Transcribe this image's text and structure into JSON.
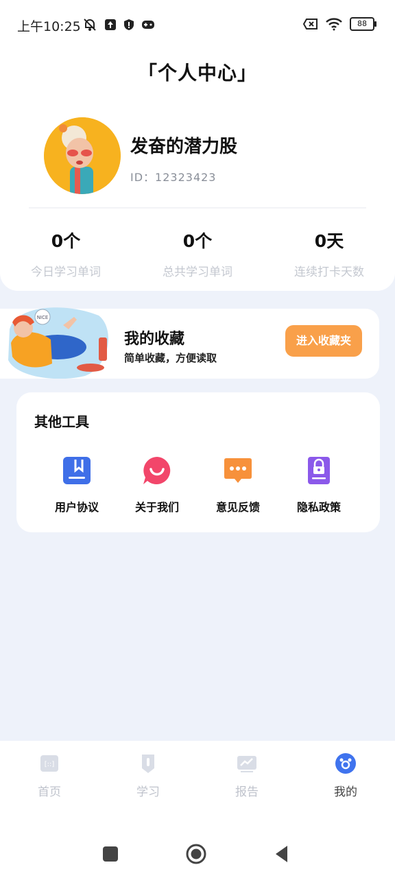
{
  "status_bar": {
    "time": "上午10:25",
    "battery": "88"
  },
  "header": {
    "title": "「个人中心」"
  },
  "profile": {
    "name": "发奋的潜力股",
    "id_text": "ID：12323423"
  },
  "stats": [
    {
      "value": "0个",
      "label": "今日学习单词"
    },
    {
      "value": "0个",
      "label": "总共学习单词"
    },
    {
      "value": "0天",
      "label": "连续打卡天数"
    }
  ],
  "favorites": {
    "title": "我的收藏",
    "subtitle": "简单收藏，方便读取",
    "button_label": "进入收藏夹",
    "illustration_text": "NICE"
  },
  "tools": {
    "title": "其他工具",
    "items": [
      {
        "label": "用户协议",
        "icon": "bookmark-book-icon",
        "color": "#3f6fe8"
      },
      {
        "label": "关于我们",
        "icon": "smile-chat-icon",
        "color": "#f2466a"
      },
      {
        "label": "意见反馈",
        "icon": "message-dots-icon",
        "color": "#f7913b"
      },
      {
        "label": "隐私政策",
        "icon": "lock-document-icon",
        "color": "#8b59ea"
      }
    ]
  },
  "tab_bar": {
    "items": [
      {
        "label": "首页",
        "icon": "home-icon"
      },
      {
        "label": "学习",
        "icon": "learn-icon"
      },
      {
        "label": "报告",
        "icon": "report-icon"
      },
      {
        "label": "我的",
        "icon": "profile-icon"
      }
    ],
    "active_index": 3,
    "active_color": "#3f73ee"
  },
  "nav_bar": {
    "buttons": [
      "recent-apps-icon",
      "home-circle-icon",
      "back-icon"
    ]
  }
}
